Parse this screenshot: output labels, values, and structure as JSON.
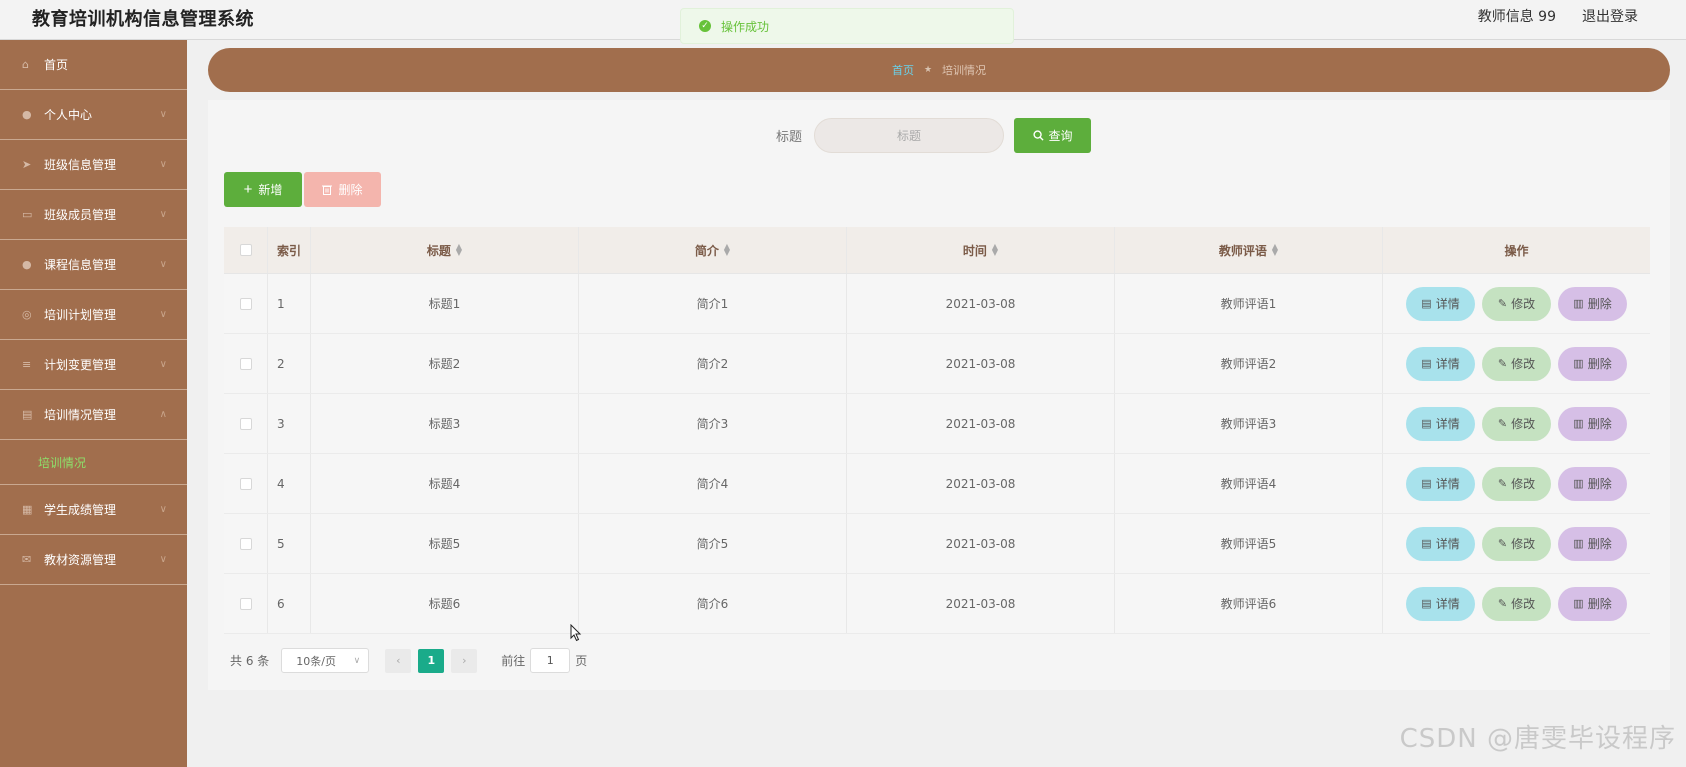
{
  "app": {
    "title": "教育培训机构信息管理系统"
  },
  "header": {
    "user": "教师信息 99",
    "logout": "退出登录"
  },
  "toast": {
    "text": "操作成功",
    "color": "#67c23a"
  },
  "sidebar": {
    "items": [
      {
        "label": "首页",
        "icon": "home-icon",
        "expandable": false
      },
      {
        "label": "个人中心",
        "icon": "user-icon",
        "expandable": true
      },
      {
        "label": "班级信息管理",
        "icon": "send-icon",
        "expandable": true
      },
      {
        "label": "班级成员管理",
        "icon": "monitor-icon",
        "expandable": true
      },
      {
        "label": "课程信息管理",
        "icon": "user-icon",
        "expandable": true
      },
      {
        "label": "培训计划管理",
        "icon": "circle-icon",
        "expandable": true
      },
      {
        "label": "计划变更管理",
        "icon": "sliders-icon",
        "expandable": true
      },
      {
        "label": "培训情况管理",
        "icon": "document-icon",
        "expandable": true,
        "expanded": true
      },
      {
        "label": "学生成绩管理",
        "icon": "chart-icon",
        "expandable": true
      },
      {
        "label": "教材资源管理",
        "icon": "mail-icon",
        "expandable": true
      }
    ],
    "active_sub": "培训情况"
  },
  "breadcrumb": {
    "home": "首页",
    "current": "培训情况"
  },
  "search": {
    "label": "标题",
    "placeholder": "标题",
    "button": "查询"
  },
  "actions": {
    "add": "新增",
    "delete": "删除"
  },
  "table": {
    "columns": [
      "索引",
      "标题",
      "简介",
      "时间",
      "教师评语",
      "操作"
    ],
    "rows": [
      {
        "index": "1",
        "title": "标题1",
        "brief": "简介1",
        "time": "2021-03-08",
        "comment": "教师评语1"
      },
      {
        "index": "2",
        "title": "标题2",
        "brief": "简介2",
        "time": "2021-03-08",
        "comment": "教师评语2"
      },
      {
        "index": "3",
        "title": "标题3",
        "brief": "简介3",
        "time": "2021-03-08",
        "comment": "教师评语3"
      },
      {
        "index": "4",
        "title": "标题4",
        "brief": "简介4",
        "time": "2021-03-08",
        "comment": "教师评语4"
      },
      {
        "index": "5",
        "title": "标题5",
        "brief": "简介5",
        "time": "2021-03-08",
        "comment": "教师评语5"
      },
      {
        "index": "6",
        "title": "标题6",
        "brief": "简介6",
        "time": "2021-03-08",
        "comment": "教师评语6"
      }
    ],
    "row_actions": {
      "detail": "详情",
      "edit": "修改",
      "delete": "删除"
    }
  },
  "pagination": {
    "total": "共 6 条",
    "page_size": "10条/页",
    "current_page": "1",
    "goto_label": "前往",
    "goto_value": "1",
    "page_suffix": "页"
  },
  "watermark": "CSDN @唐雯毕设程序"
}
